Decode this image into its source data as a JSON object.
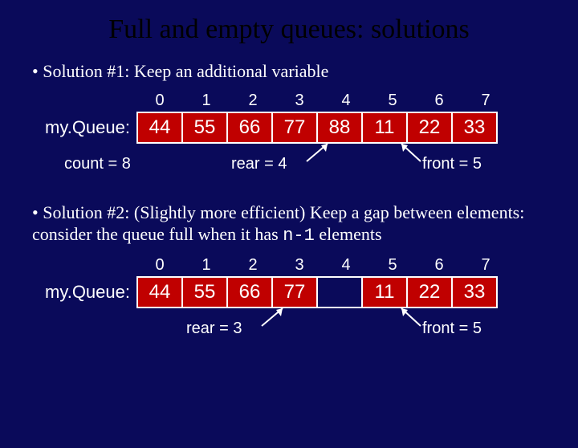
{
  "title": "Full and empty queues: solutions",
  "solution1": {
    "bullet": "Solution #1: Keep an additional variable",
    "queueLabel": "my.Queue:",
    "indices": [
      "0",
      "1",
      "2",
      "3",
      "4",
      "5",
      "6",
      "7"
    ],
    "cells": [
      {
        "v": "44",
        "filled": true
      },
      {
        "v": "55",
        "filled": true
      },
      {
        "v": "66",
        "filled": true
      },
      {
        "v": "77",
        "filled": true
      },
      {
        "v": "88",
        "filled": true
      },
      {
        "v": "11",
        "filled": true
      },
      {
        "v": "22",
        "filled": true
      },
      {
        "v": "33",
        "filled": true
      }
    ],
    "count": "count = 8",
    "rear": "rear = 4",
    "front": "front = 5"
  },
  "solution2": {
    "bullet_a": "Solution #2: (Slightly more efficient) Keep a gap between elements: consider the queue full when it has ",
    "bullet_b": "n-1",
    "bullet_c": " elements",
    "queueLabel": "my.Queue:",
    "indices": [
      "0",
      "1",
      "2",
      "3",
      "4",
      "5",
      "6",
      "7"
    ],
    "cells": [
      {
        "v": "44",
        "filled": true
      },
      {
        "v": "55",
        "filled": true
      },
      {
        "v": "66",
        "filled": true
      },
      {
        "v": "77",
        "filled": true
      },
      {
        "v": "",
        "filled": false
      },
      {
        "v": "11",
        "filled": true
      },
      {
        "v": "22",
        "filled": true
      },
      {
        "v": "33",
        "filled": true
      }
    ],
    "rear": "rear = 3",
    "front": "front = 5"
  },
  "chart_data": [
    {
      "type": "table",
      "title": "Solution 1 queue (extra count variable)",
      "indices": [
        0,
        1,
        2,
        3,
        4,
        5,
        6,
        7
      ],
      "values": [
        44,
        55,
        66,
        77,
        88,
        11,
        22,
        33
      ],
      "count": 8,
      "rear": 4,
      "front": 5
    },
    {
      "type": "table",
      "title": "Solution 2 queue (gap, full at n-1)",
      "indices": [
        0,
        1,
        2,
        3,
        4,
        5,
        6,
        7
      ],
      "values": [
        44,
        55,
        66,
        77,
        null,
        11,
        22,
        33
      ],
      "rear": 3,
      "front": 5
    }
  ]
}
